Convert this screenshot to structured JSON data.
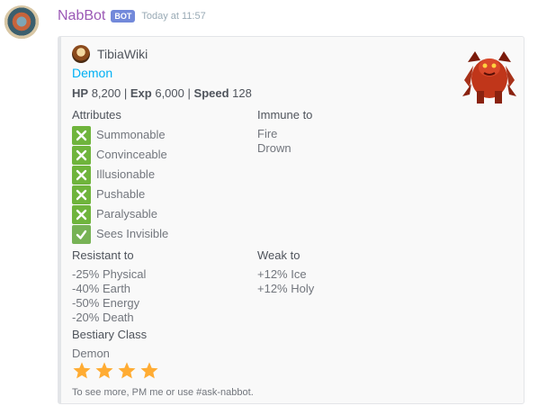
{
  "message": {
    "username": "NabBot",
    "bot_tag": "BOT",
    "timestamp": "Today at 11:57"
  },
  "embed": {
    "author": "TibiaWiki",
    "title": "Demon",
    "stats": {
      "hp_label": "HP",
      "hp_value": "8,200",
      "exp_label": "Exp",
      "exp_value": "6,000",
      "speed_label": "Speed",
      "speed_value": "128",
      "separator": "|"
    },
    "attributes": {
      "name": "Attributes",
      "items": [
        {
          "label": "Summonable",
          "status": "no"
        },
        {
          "label": "Convinceable",
          "status": "no"
        },
        {
          "label": "Illusionable",
          "status": "no"
        },
        {
          "label": "Pushable",
          "status": "no"
        },
        {
          "label": "Paralysable",
          "status": "no"
        },
        {
          "label": "Sees Invisible",
          "status": "yes"
        }
      ]
    },
    "immune": {
      "name": "Immune to",
      "values": [
        "Fire",
        "Drown"
      ]
    },
    "resistant": {
      "name": "Resistant to",
      "values": [
        "-25% Physical",
        "-40% Earth",
        "-50% Energy",
        "-20% Death"
      ]
    },
    "weak": {
      "name": "Weak to",
      "values": [
        "+12% Ice",
        "+12% Holy"
      ]
    },
    "bestiary": {
      "name": "Bestiary Class",
      "value": "Demon",
      "stars": 4
    },
    "footer": "To see more, PM me or use #ask-nabbot."
  },
  "colors": {
    "username": "#9b59b6",
    "bot_tag": "#7289da",
    "title_link": "#00b0f4",
    "star": "#ffac33",
    "check_green": "#77b255"
  }
}
